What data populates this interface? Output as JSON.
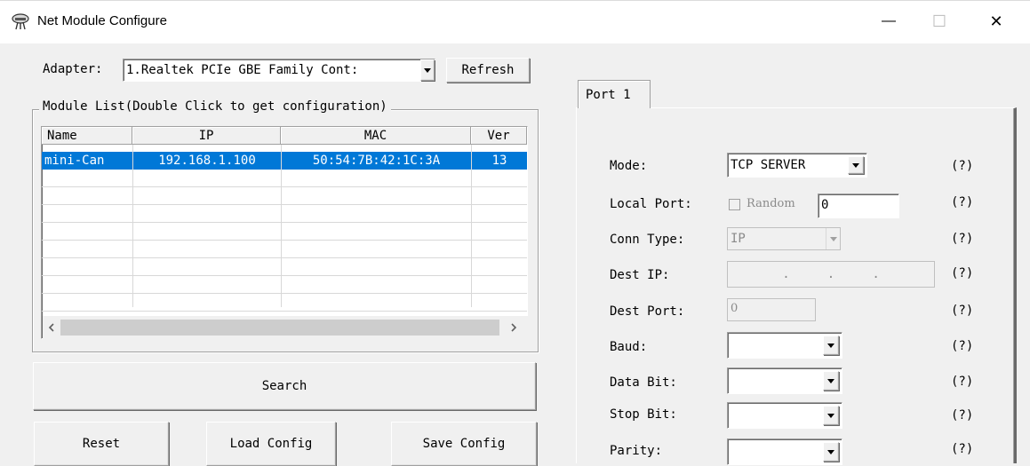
{
  "window": {
    "title": "Net Module Configure",
    "minimize": "—",
    "maximize": "☐",
    "close": "✕"
  },
  "adapter": {
    "label": "Adapter:",
    "value": "1.Realtek PCIe GBE Family Cont:",
    "refresh": "Refresh"
  },
  "module_list": {
    "title": "Module List(Double Click to get configuration)",
    "columns": [
      "Name",
      "IP",
      "MAC",
      "Ver"
    ],
    "rows": [
      {
        "name": "mini-Can",
        "ip": "192.168.1.100",
        "mac": "50:54:7B:42:1C:3A",
        "ver": "13"
      }
    ]
  },
  "buttons": {
    "search": "Search",
    "reset": "Reset",
    "load": "Load Config",
    "save": "Save Config"
  },
  "tab": {
    "label": "Port 1"
  },
  "form": {
    "help": "(?)",
    "mode_label": "Mode:",
    "mode_value": "TCP SERVER",
    "local_port_label": "Local Port:",
    "random_label": "Random",
    "local_port_value": "0",
    "conn_type_label": "Conn Type:",
    "conn_type_value": "IP",
    "dest_ip_label": "Dest IP:",
    "dest_ip_dots": ".     .     .",
    "dest_port_label": "Dest Port:",
    "dest_port_value": "0",
    "baud_label": "Baud:",
    "data_bit_label": "Data Bit:",
    "stop_bit_label": "Stop Bit:",
    "parity_label": "Parity:"
  },
  "colors": {
    "selection": "#0078d7",
    "background": "#f0f0f0"
  }
}
